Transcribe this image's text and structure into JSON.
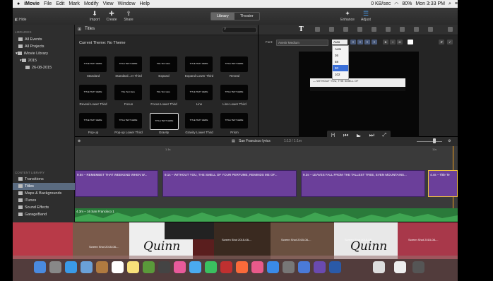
{
  "menubar": {
    "apple": "",
    "app": "iMovie",
    "items": [
      "File",
      "Edit",
      "Mark",
      "Modify",
      "View",
      "Window",
      "Help"
    ],
    "right_battery": "80%",
    "right_time": "Mon 3:33 PM",
    "right_speed": "0 KB/sec"
  },
  "toolbar": {
    "hide_label": "Hide",
    "import_label": "Import",
    "create_label": "Create",
    "share_label": "Share",
    "library_tab": "Library",
    "theater_tab": "Theater",
    "enhance_label": "Enhance",
    "adjust_label": "Adjust"
  },
  "libraries": {
    "header": "LIBRARIES",
    "items": [
      "All Events",
      "All Projects",
      "iMovie Library",
      "2015",
      "26-08-2015"
    ]
  },
  "browser": {
    "title": "Titles",
    "current_theme": "Current Theme: No Theme",
    "tiles": [
      {
        "label": "Standard",
        "text": "TITLE TEXT HERE"
      },
      {
        "label": "Standard...er Third",
        "text": "TITLE TEXT HERE"
      },
      {
        "label": "Expand",
        "text": "Title Text Here"
      },
      {
        "label": "Expand Lower Third",
        "text": "TITLE TEXT HERE"
      },
      {
        "label": "Reveal",
        "text": "TITLE TEXT HERE"
      },
      {
        "label": "Reveal Lower Third",
        "text": "TITLE TEXT HERE"
      },
      {
        "label": "Focus",
        "text": "Title Text Here"
      },
      {
        "label": "Focus Lower Third",
        "text": "Title Text Here"
      },
      {
        "label": "Line",
        "text": "TITLE TEXT HERE"
      },
      {
        "label": "Line Lower Third",
        "text": "TITLE TEXT HERE"
      },
      {
        "label": "Pop-up",
        "text": "TITLE TEXT HERE"
      },
      {
        "label": "Pop-up Lower Third",
        "text": "TITLE TEXT HERE"
      },
      {
        "label": "Gravity",
        "text": "TITLE TEXT HERE"
      },
      {
        "label": "Gravity Lower Third",
        "text": "TITLE TEXT HERE"
      },
      {
        "label": "Prism",
        "text": "TITLE TEXT HERE"
      }
    ]
  },
  "viewer": {
    "font_label": "Font:",
    "font_value": "Avenir Medium",
    "size_value": "Auto",
    "size_options": [
      "Auto",
      "36",
      "58",
      "80",
      "102"
    ],
    "overlay_text": "— WITHOUT YOU, THE SMELL OF"
  },
  "timeline": {
    "project": "San Francisco lyrics",
    "duration": "1:13 / 1:1m",
    "ruler": [
      "1.1s",
      "",
      "11s",
      ""
    ],
    "clips": [
      "9.5s – REMEMBET THAT WEEKEND WHEN W...",
      "9.1s – WITHOUT YOU, THE SMELL OF YOUR PERFUME, REMINDS ME OF...",
      "9.3s – LEAVES FALL FROM THE TALLEST TREE, EVEN MOUNTAINS...",
      "4.4s – Title Te"
    ],
    "audio": "4.3m – 16 San Francisco 1"
  },
  "content_library": {
    "header": "CONTENT LIBRARY",
    "items": [
      "Transitions",
      "Titles",
      "Maps & Backgrounds",
      "iTunes",
      "Sound Effects",
      "GarageBand"
    ]
  },
  "desktop": {
    "quinn": "Quinn",
    "files": [
      "Screen Shot 2015-08-...",
      "Screen Shot 2015-08-...",
      "Screen Shot 2015-08-...",
      "Screen Shot 2015-08-...",
      "Screen Shot 2015-08-..."
    ]
  }
}
